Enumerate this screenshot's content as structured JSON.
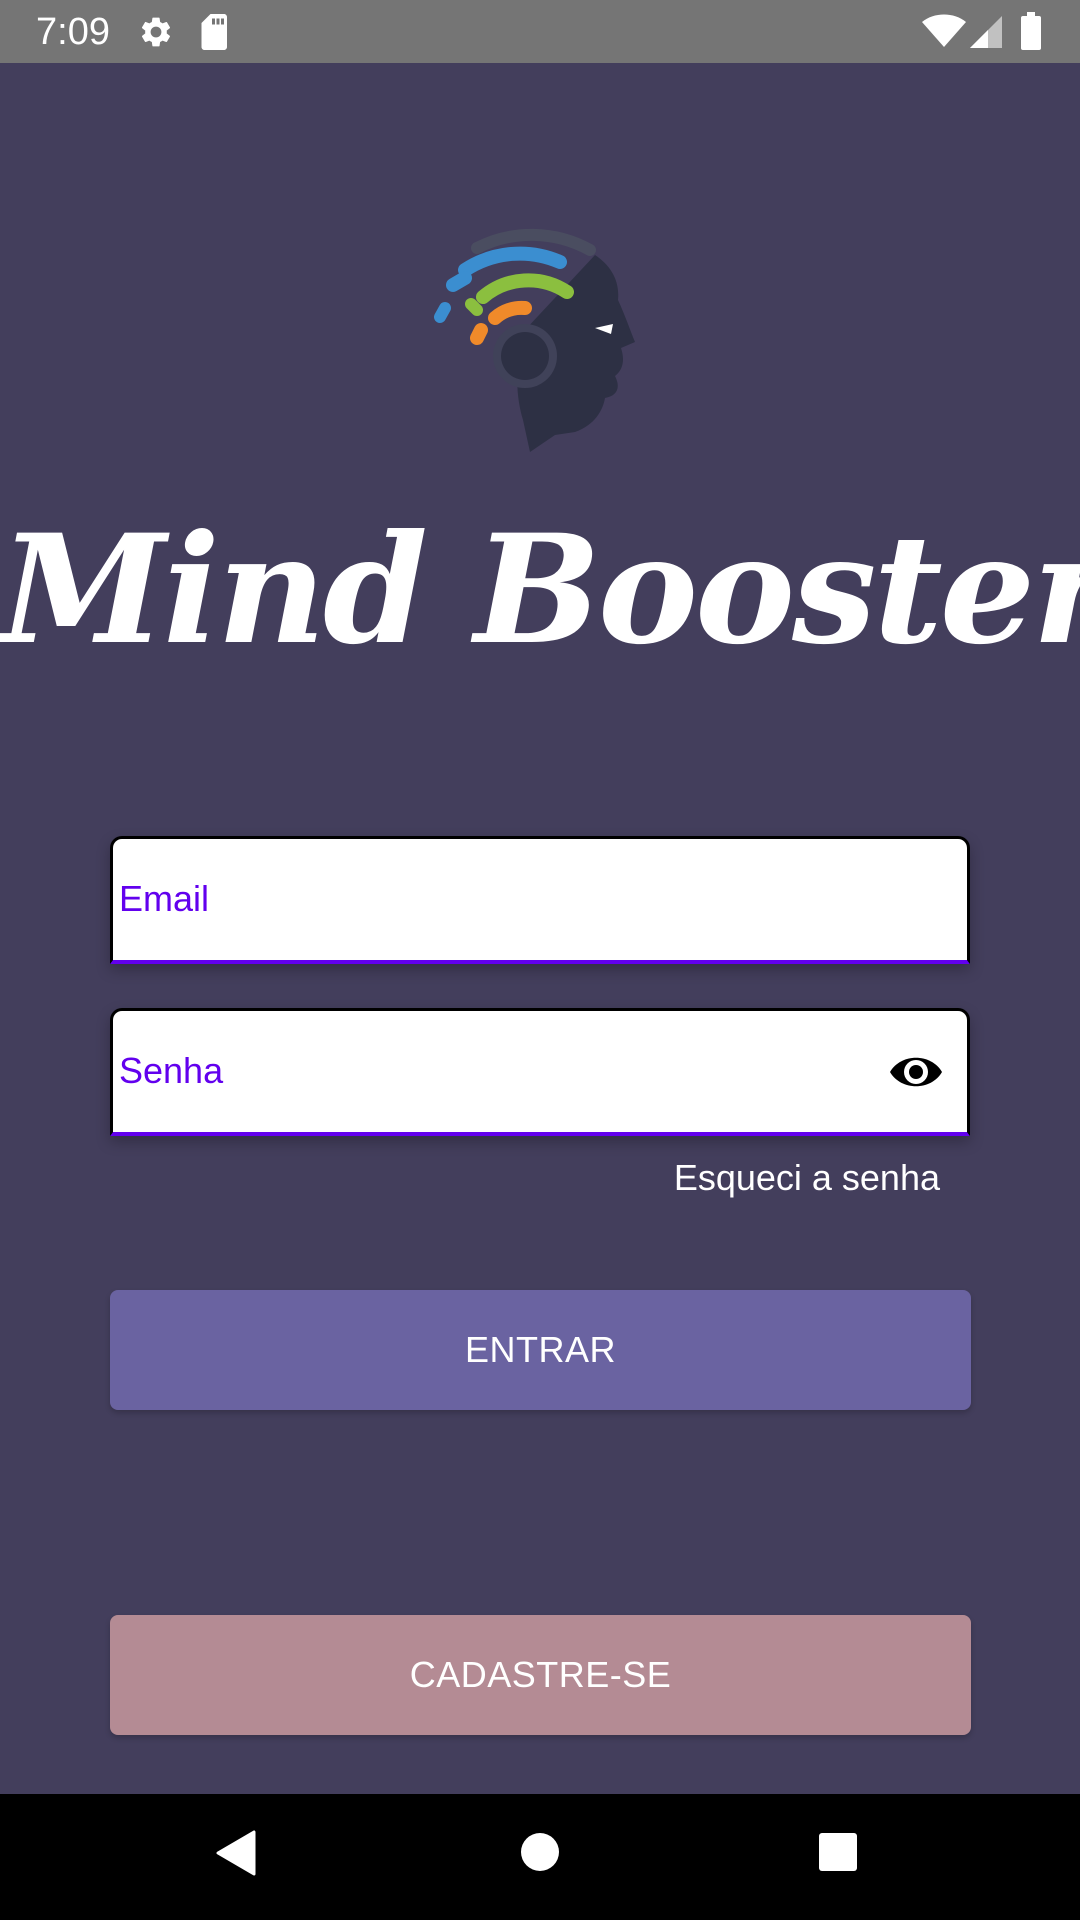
{
  "status_bar": {
    "time": "7:09",
    "icons": [
      "settings-icon",
      "sd-card-icon",
      "wifi-icon",
      "cell-signal-icon",
      "battery-icon"
    ]
  },
  "app": {
    "title": "Mind Booster",
    "logo": "brain-signal-logo"
  },
  "form": {
    "email_placeholder": "Email",
    "password_placeholder": "Senha",
    "password_toggle_icon": "eye-icon",
    "forgot_label": "Esqueci a senha",
    "login_label": "ENTRAR",
    "signup_label": "CADASTRE-SE"
  },
  "nav_bar": {
    "buttons": [
      "back-icon",
      "home-icon",
      "recents-icon"
    ]
  },
  "colors": {
    "background": "#433e5c",
    "accent": "#6200ee",
    "login_button": "#6a63a1",
    "signup_button": "#b48b94"
  }
}
